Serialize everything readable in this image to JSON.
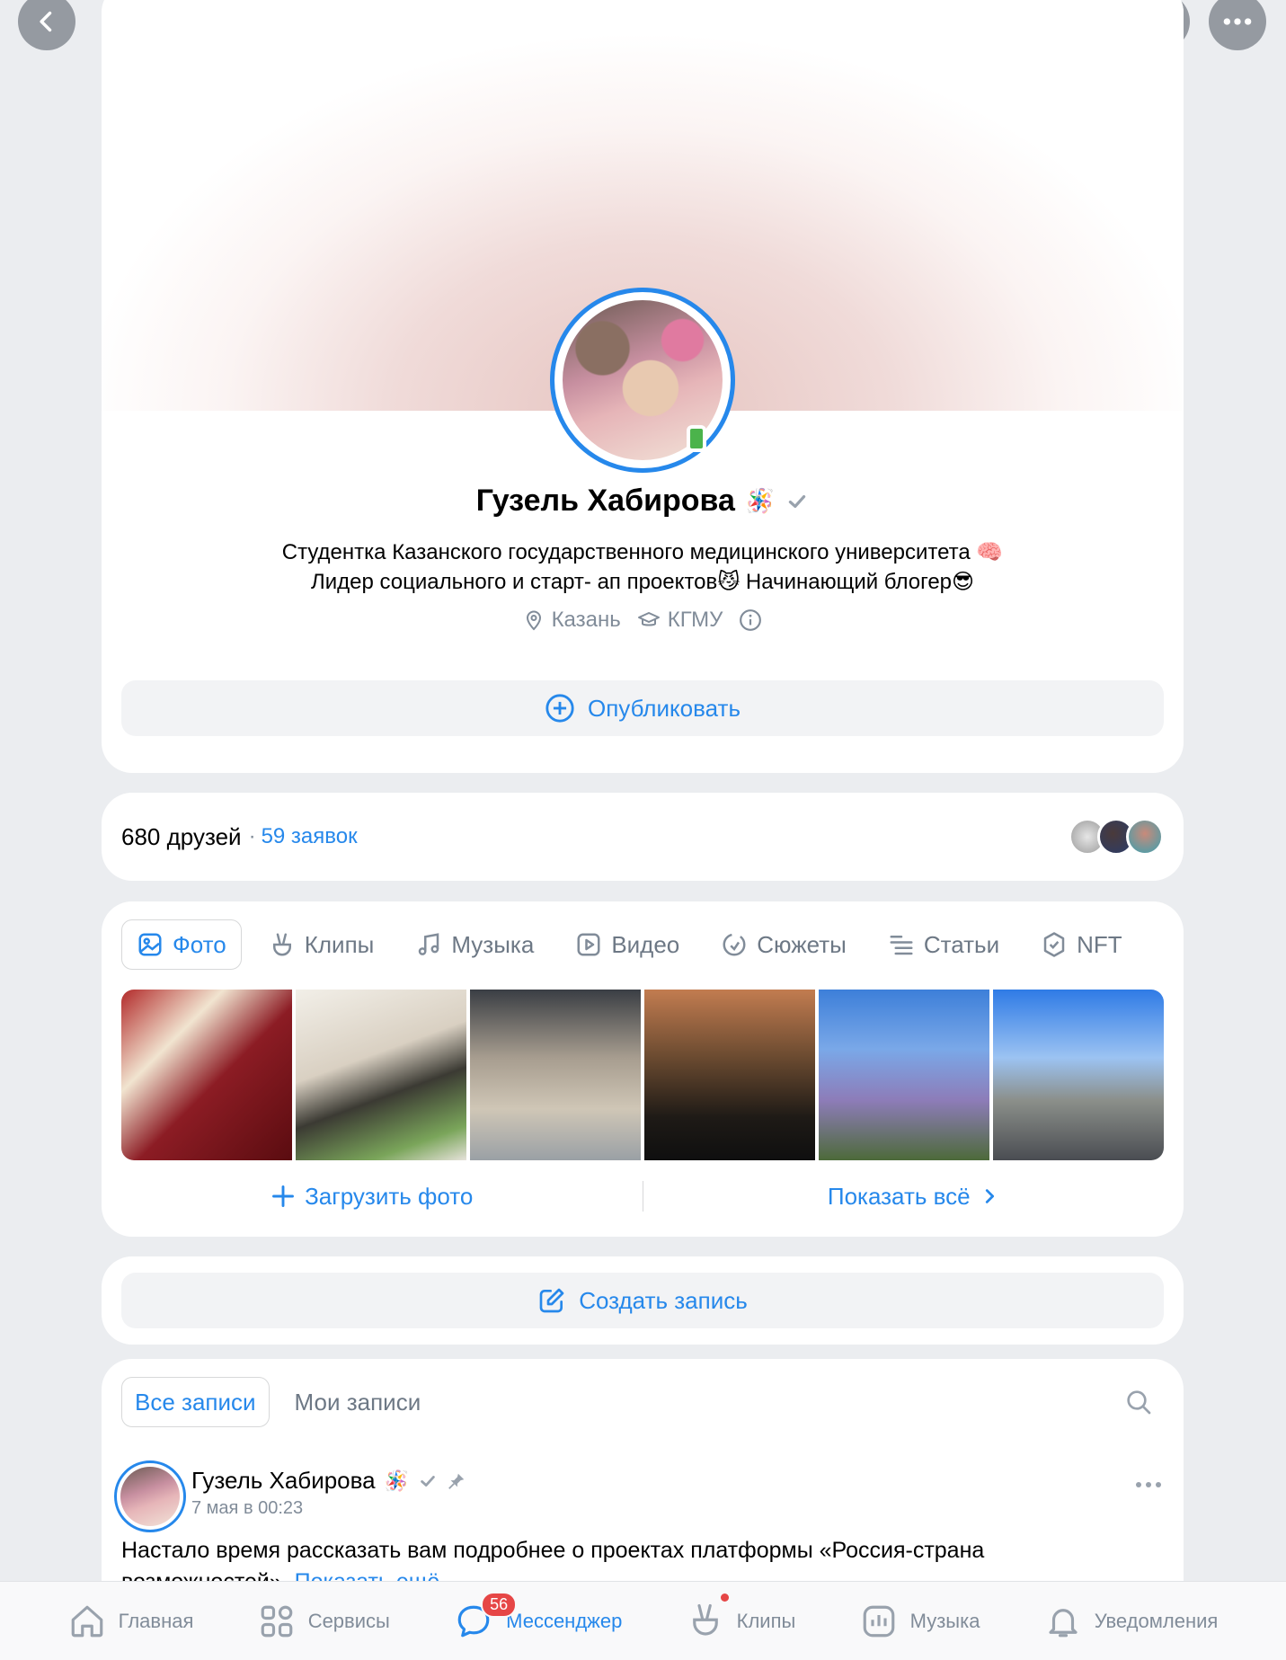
{
  "profile": {
    "name": "Гузель Хабирова",
    "status_emoji": "🪅",
    "bio_line1": "Студентка Казанского государственного медицинского университета 🧠",
    "bio_line2": "Лидер социального и старт- ап проектов😼 Начинающий блогер😎",
    "city": "Казань",
    "university": "КГМУ",
    "publish_label": "Опубликовать"
  },
  "friends": {
    "count_label": "680 друзей",
    "separator": "·",
    "requests_label": "59 заявок"
  },
  "media": {
    "tabs": [
      {
        "label": "Фото",
        "icon": "image-icon"
      },
      {
        "label": "Клипы",
        "icon": "clips-icon"
      },
      {
        "label": "Музыка",
        "icon": "music-icon"
      },
      {
        "label": "Видео",
        "icon": "video-icon"
      },
      {
        "label": "Сюжеты",
        "icon": "stories-icon"
      },
      {
        "label": "Статьи",
        "icon": "articles-icon"
      },
      {
        "label": "NFT",
        "icon": "nft-icon"
      }
    ],
    "upload_label": "Загрузить фото",
    "show_all_label": "Показать всё"
  },
  "create_post": {
    "label": "Создать запись"
  },
  "feed": {
    "tab_all": "Все записи",
    "tab_mine": "Мои записи",
    "post": {
      "author": "Гузель Хабирова",
      "emoji": "🪅",
      "date": "7 мая в 00:23",
      "text_line1": "Настало время рассказать вам подробнее о проектах платформы «Россия-страна",
      "text_line2": "возможностей». ",
      "show_more": "Показать ещё"
    }
  },
  "bottom_nav": {
    "home": "Главная",
    "services": "Сервисы",
    "messenger": "Мессенджер",
    "messenger_badge": "56",
    "clips": "Клипы",
    "music": "Музыка",
    "notifications": "Уведомления"
  },
  "colors": {
    "accent": "#2688eb",
    "secondary_text": "#818c99",
    "badge": "#e64646"
  }
}
